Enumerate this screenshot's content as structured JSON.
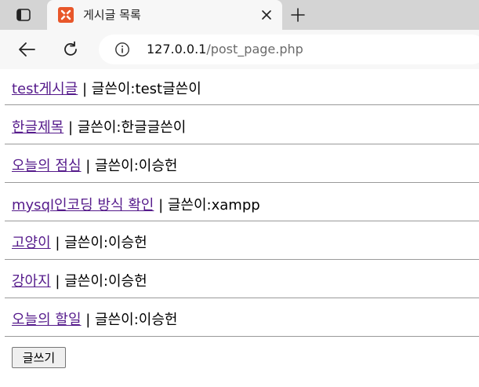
{
  "browser": {
    "tab_title": "게시글 목록",
    "url_host": "127.0.0.1",
    "url_path": "/post_page.php"
  },
  "posts": [
    {
      "title": "test게시글",
      "separator": " | 글쓴이:",
      "author": "test글쓴이"
    },
    {
      "title": "한글제목",
      "separator": " | 글쓴이:",
      "author": "한글글쓴이"
    },
    {
      "title": "오늘의 점심",
      "separator": " | 글쓴이:",
      "author": "이승헌"
    },
    {
      "title": "mysql인코딩 방식 확인",
      "separator": " | 글쓴이:",
      "author": "xampp"
    },
    {
      "title": "고양이",
      "separator": " | 글쓴이:",
      "author": "이승헌"
    },
    {
      "title": "강아지",
      "separator": " | 글쓴이:",
      "author": "이승헌"
    },
    {
      "title": "오늘의 할일",
      "separator": " | 글쓴이:",
      "author": "이승헌"
    }
  ],
  "write_button_label": "글쓰기",
  "colors": {
    "link_visited": "#551a8b",
    "tab_strip": "#d4d4d4",
    "toolbar": "#f7f7f7",
    "favicon": "#e8572a"
  }
}
